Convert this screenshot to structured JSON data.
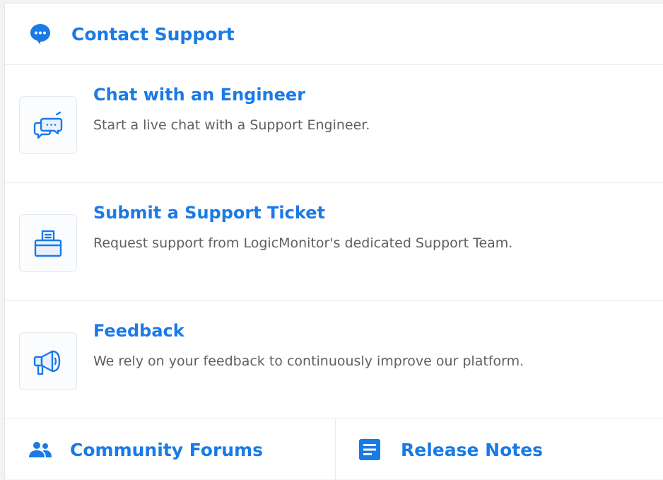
{
  "header": {
    "title": "Contact Support",
    "icon": "chat-bubble-icon"
  },
  "items": [
    {
      "title": "Chat with an Engineer",
      "description": "Start a live chat with a Support Engineer.",
      "icon": "chat-engineer-icon"
    },
    {
      "title": "Submit a Support Ticket",
      "description": "Request support from LogicMonitor's dedicated Support Team.",
      "icon": "ticket-icon"
    },
    {
      "title": "Feedback",
      "description": "We rely on your feedback to continuously improve our platform.",
      "icon": "megaphone-icon"
    }
  ],
  "footer": {
    "community_label": "Community Forums",
    "community_icon": "people-icon",
    "release_label": "Release Notes",
    "release_icon": "document-icon"
  },
  "colors": {
    "accent": "#1a7ae6",
    "text_secondary": "#5c5f64",
    "border": "#e9ebee"
  }
}
